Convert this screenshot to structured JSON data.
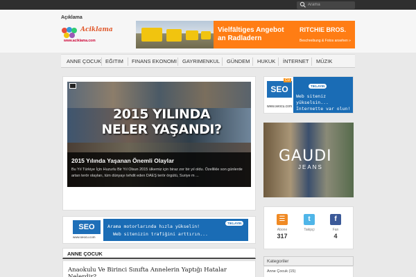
{
  "topbar": {
    "search_placeholder": "Arama"
  },
  "header": {
    "site_title": "Açıklama",
    "logo_text": "Aciklama",
    "logo_url": "www.aciklama.com",
    "ad": {
      "headline": "Vielfältiges Angebot an Radladern",
      "brand": "RITCHIE BROS.",
      "brand_sub": "Beschreibung & Fotos ansehen »"
    }
  },
  "nav": {
    "items": [
      {
        "label": "ANNE ÇOCUK"
      },
      {
        "label": "EĞITIM"
      },
      {
        "label": "FINANS EKONOMI"
      },
      {
        "label": "GAYRIMENKUL"
      },
      {
        "label": "GÜNDEM"
      },
      {
        "label": "HUKUK"
      },
      {
        "label": "İNTERNET"
      },
      {
        "label": "MÜZIK"
      }
    ]
  },
  "slider": {
    "image_headline": "2015 YILINDA NELER YAŞANDI?",
    "title": "2015 Yılında Yaşanan Önemli Olaylar",
    "excerpt": "Bu Yıl Türkiye İçin Huzurlu Bir Yıl Olsun 2015 ülkemiz için biraz zor bir yıl oldu. Özellikle son günlerde artan terör olayları, tüm dünyayı tehdit eden DAEŞ terör örgütü, Suriye m ..."
  },
  "seo_ad": {
    "logo": "SEO",
    "badge": "CU",
    "domain": "www.seocu.com",
    "cta": "TIKLAYIN",
    "line1": "Web siteniz",
    "line2": "yükselsin...",
    "line3": "İnternette var olun!"
  },
  "gaudi_ad": {
    "title": "GAUDI",
    "subtitle": "JEANS"
  },
  "social": {
    "items": [
      {
        "icon": "rss-icon",
        "label": "Abone",
        "count": "317",
        "color": "#f08a24"
      },
      {
        "icon": "twitter-icon",
        "label": "Takipçi",
        "count": "",
        "color": "#4fb5e8"
      },
      {
        "icon": "facebook-icon",
        "label": "Fan",
        "count": "4",
        "color": "#3b5998"
      }
    ]
  },
  "inline_ad": {
    "logo": "SEO",
    "domain": "www.seocu.com",
    "line1": "Arama motorlarında hızla yükselin!",
    "line2": "Web sitenizin trafiğini arttırın...",
    "cta": "TIKLAYIN"
  },
  "section": {
    "title": "ANNE ÇOCUK",
    "article_title": "Anaokulu Ve Birinci Sınıfta Annelerin Yaptığı Hatalar Nelerdir?"
  },
  "categories": {
    "title": "Kategoriler",
    "items": [
      {
        "label": "Anne Çocuk (15)"
      }
    ]
  }
}
